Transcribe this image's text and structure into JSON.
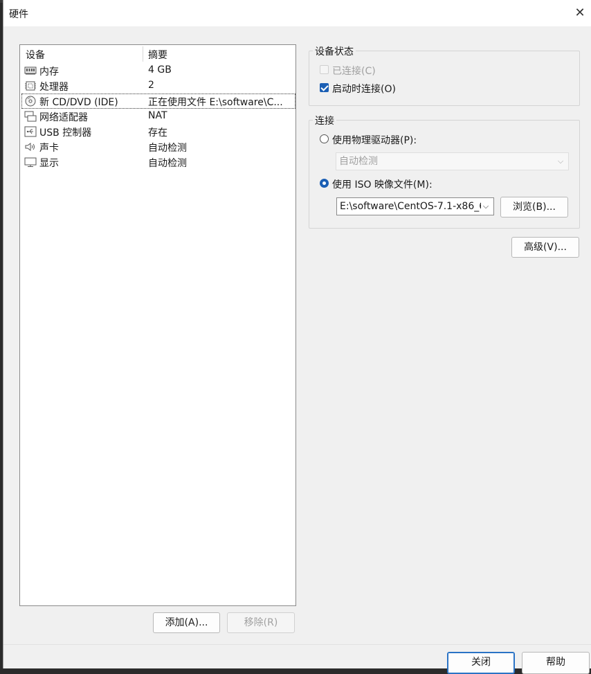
{
  "window": {
    "title": "硬件"
  },
  "device_list": {
    "columns": [
      "设备",
      "摘要"
    ],
    "rows": [
      {
        "name": "内存",
        "summary": "4 GB",
        "icon": "memory-icon"
      },
      {
        "name": "处理器",
        "summary": "2",
        "icon": "processor-icon"
      },
      {
        "name": "新 CD/DVD (IDE)",
        "summary": "正在使用文件 E:\\software\\C...",
        "icon": "cd-dvd-icon",
        "selected": true
      },
      {
        "name": "网络适配器",
        "summary": "NAT",
        "icon": "network-adapter-icon"
      },
      {
        "name": "USB 控制器",
        "summary": "存在",
        "icon": "usb-icon"
      },
      {
        "name": "声卡",
        "summary": "自动检测",
        "icon": "speaker-icon"
      },
      {
        "name": "显示",
        "summary": "自动检测",
        "icon": "display-icon"
      }
    ],
    "add_label": "添加(A)...",
    "remove_label": "移除(R)"
  },
  "device_status": {
    "title": "设备状态",
    "connected_label": "已连接(C)",
    "connected_checked": false,
    "connected_enabled": false,
    "connect_at_power_on_label": "启动时连接(O)",
    "connect_at_power_on_checked": true
  },
  "connection": {
    "title": "连接",
    "physical_drive_label": "使用物理驱动器(P):",
    "physical_drive_selected": false,
    "physical_drive_value": "自动检测",
    "iso_label": "使用 ISO 映像文件(M):",
    "iso_selected": true,
    "iso_path": "E:\\software\\CentOS-7.1-x86_6",
    "browse_label": "浏览(B)..."
  },
  "advanced_label": "高级(V)...",
  "footer": {
    "close_label": "关闭",
    "help_label": "帮助"
  },
  "colors": {
    "accent": "#1b5fb4",
    "primary_border": "#2a73c5"
  }
}
